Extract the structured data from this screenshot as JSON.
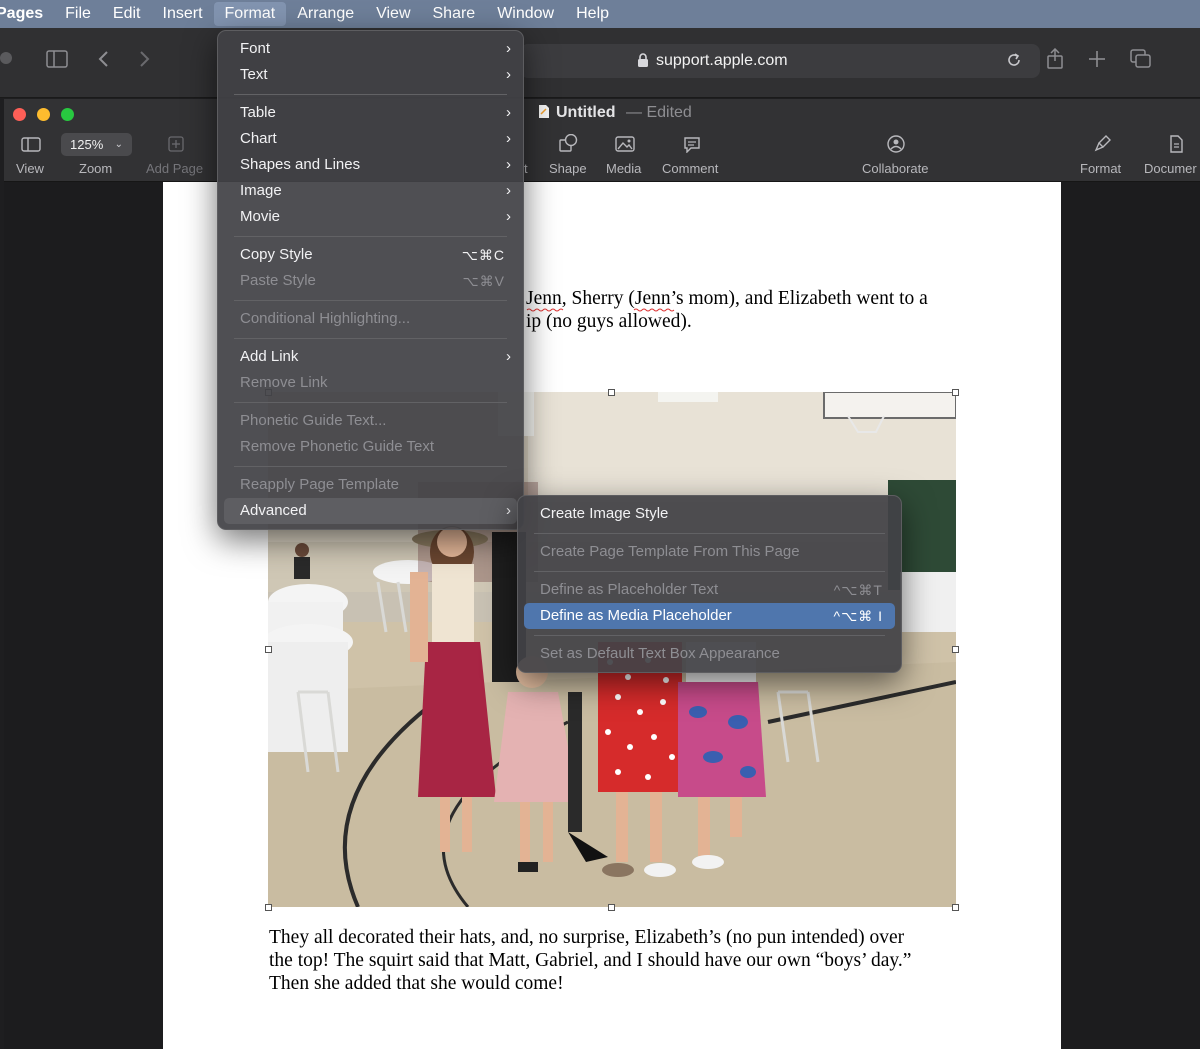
{
  "menubar": {
    "app": "Pages",
    "items": [
      "File",
      "Edit",
      "Insert",
      "Format",
      "Arrange",
      "View",
      "Share",
      "Window",
      "Help"
    ],
    "open_menu": "Format"
  },
  "safari": {
    "url": "support.apple.com"
  },
  "window": {
    "title": "Untitled",
    "subtitle": "— Edited"
  },
  "toolbar": {
    "view_label": "View",
    "zoom_value": "125%",
    "zoom_label": "Zoom",
    "add_page_label": "Add Page",
    "partial_label": "t",
    "shape_label": "Shape",
    "media_label": "Media",
    "comment_label": "Comment",
    "collaborate_label": "Collaborate",
    "format_label": "Format",
    "document_label": "Documer"
  },
  "document": {
    "line1": "Jenn, Sherry (Jenn’s mom), and Elizabeth went to a",
    "line2": "ip (no guys allowed).",
    "para_line1": "They all decorated their hats, and, no surprise, Elizabeth’s (no pun intended) over",
    "para_line2": "the top! The squirt said that Matt, Gabriel, and I should have our own “boys’ day.”",
    "para_line3": "Then she added that she would come!"
  },
  "format_menu": {
    "font": "Font",
    "text": "Text",
    "table": "Table",
    "chart": "Chart",
    "shapes_and_lines": "Shapes and Lines",
    "image": "Image",
    "movie": "Movie",
    "copy_style": "Copy Style",
    "copy_style_shortcut": "⌥⌘C",
    "paste_style": "Paste Style",
    "paste_style_shortcut": "⌥⌘V",
    "conditional_highlighting": "Conditional Highlighting...",
    "add_link": "Add Link",
    "remove_link": "Remove Link",
    "phonetic_guide_text": "Phonetic Guide Text...",
    "remove_phonetic_guide_text": "Remove Phonetic Guide Text",
    "reapply_page_template": "Reapply Page Template",
    "advanced": "Advanced"
  },
  "advanced_submenu": {
    "create_image_style": "Create Image Style",
    "create_page_template": "Create Page Template From This Page",
    "define_placeholder_text": "Define as Placeholder Text",
    "define_placeholder_text_shortcut": "^⌥⌘T",
    "define_media_placeholder": "Define as Media Placeholder",
    "define_media_placeholder_shortcut": "^⌥⌘ I",
    "set_default_text_box": "Set as Default Text Box Appearance"
  },
  "colors": {
    "menubar": "#6e7f99",
    "highlight": "#4f76ad"
  }
}
